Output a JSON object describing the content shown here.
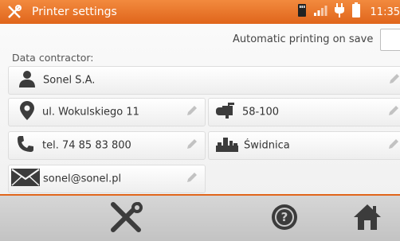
{
  "header": {
    "title": "Printer settings",
    "time": "11:35",
    "icons": [
      "tools-icon",
      "sd-card-icon",
      "signal-icon",
      "plug-icon",
      "battery-icon"
    ]
  },
  "settings": {
    "auto_print_label": "Automatic printing on save",
    "auto_print_checked": false
  },
  "contractor": {
    "section_label": "Data contractor:",
    "name": "Sonel S.A.",
    "street": "ul. Wokulskiego 11",
    "postal_code": "58-100",
    "phone": "tel. 74 85 83 800",
    "city": "Świdnica",
    "email": "sonel@sonel.pl"
  },
  "footer": {
    "buttons": [
      "settings-tools-icon",
      "help-icon",
      "home-icon"
    ]
  },
  "colors": {
    "accent": "#e0651b",
    "icon": "#3c3c3c",
    "pencil": "#c2c2c2",
    "footer_bg": "#cccccc"
  }
}
